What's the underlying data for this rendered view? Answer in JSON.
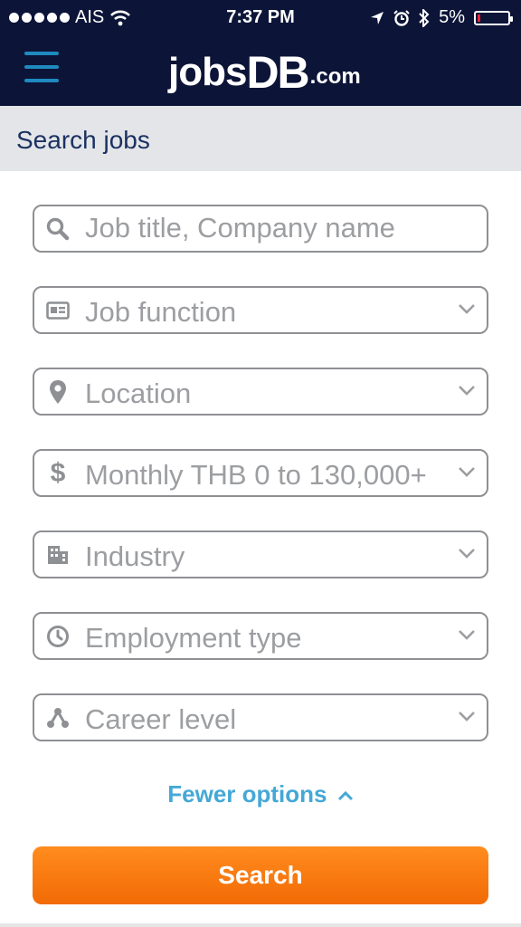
{
  "status_bar": {
    "carrier": "AIS",
    "time": "7:37 PM",
    "battery": "5%"
  },
  "header": {
    "logo_jobs": "jobs",
    "logo_db": "DB",
    "logo_com": ".com"
  },
  "page": {
    "title": "Search jobs"
  },
  "form": {
    "keyword_placeholder": "Job title, Company name",
    "job_function": "Job function",
    "location": "Location",
    "salary": "Monthly THB 0 to 130,000+",
    "industry": "Industry",
    "employment_type": "Employment type",
    "career_level": "Career level"
  },
  "actions": {
    "fewer_options": "Fewer options",
    "search": "Search"
  },
  "colors": {
    "header_bg": "#0c1438",
    "accent_blue": "#45a8d6",
    "search_orange": "#f57a10"
  }
}
